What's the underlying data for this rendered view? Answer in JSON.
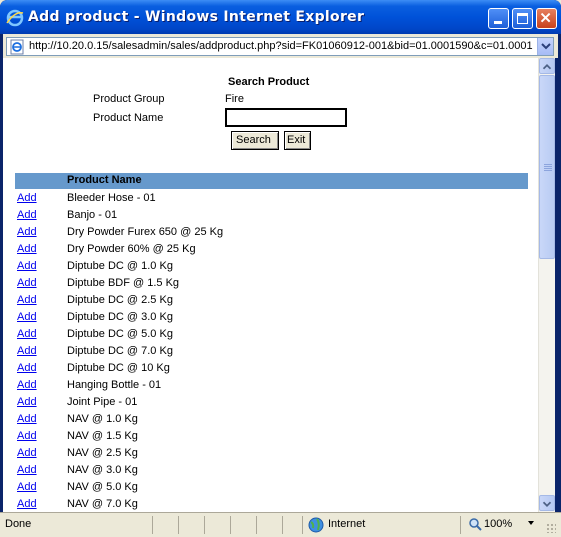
{
  "window": {
    "title": "Add product - Windows Internet Explorer",
    "icon": "ie-icon",
    "buttons": [
      "minimize-icon",
      "maximize-icon",
      "close-icon"
    ]
  },
  "address": {
    "url": "http://10.20.0.15/salesadmin/sales/addproduct.php?sid=FK01060912-001&bid=01.0001590&c=01.0001"
  },
  "search": {
    "heading": "Search Product",
    "group_label": "Product Group",
    "group_value": "Fire",
    "name_label": "Product Name",
    "name_value": "",
    "search_button": "Search",
    "exit_button": "Exit"
  },
  "table": {
    "header_name": "Product Name",
    "add_label": "Add",
    "rows": [
      "Bleeder Hose - 01",
      "Banjo - 01",
      "Dry Powder Furex 650 @ 25 Kg",
      "Dry Powder 60% @ 25 Kg",
      "Diptube DC @ 1.0 Kg",
      "Diptube BDF @ 1.5 Kg",
      "Diptube DC @ 2.5 Kg",
      "Diptube DC @ 3.0 Kg",
      "Diptube DC @ 5.0 Kg",
      "Diptube DC @ 7.0 Kg",
      "Diptube DC @ 10 Kg",
      "Hanging Bottle - 01",
      "Joint Pipe - 01",
      "NAV @ 1.0 Kg",
      "NAV @ 1.5 Kg",
      "NAV @ 2.5 Kg",
      "NAV @ 3.0 Kg",
      "NAV @ 5.0 Kg",
      "NAV @ 7.0 Kg"
    ]
  },
  "status": {
    "text": "Done",
    "zone": "Internet",
    "zoom": "100%"
  },
  "colors": {
    "titlebar": "#0052d9",
    "table_header": "#6699cc",
    "link": "#0000ee"
  }
}
